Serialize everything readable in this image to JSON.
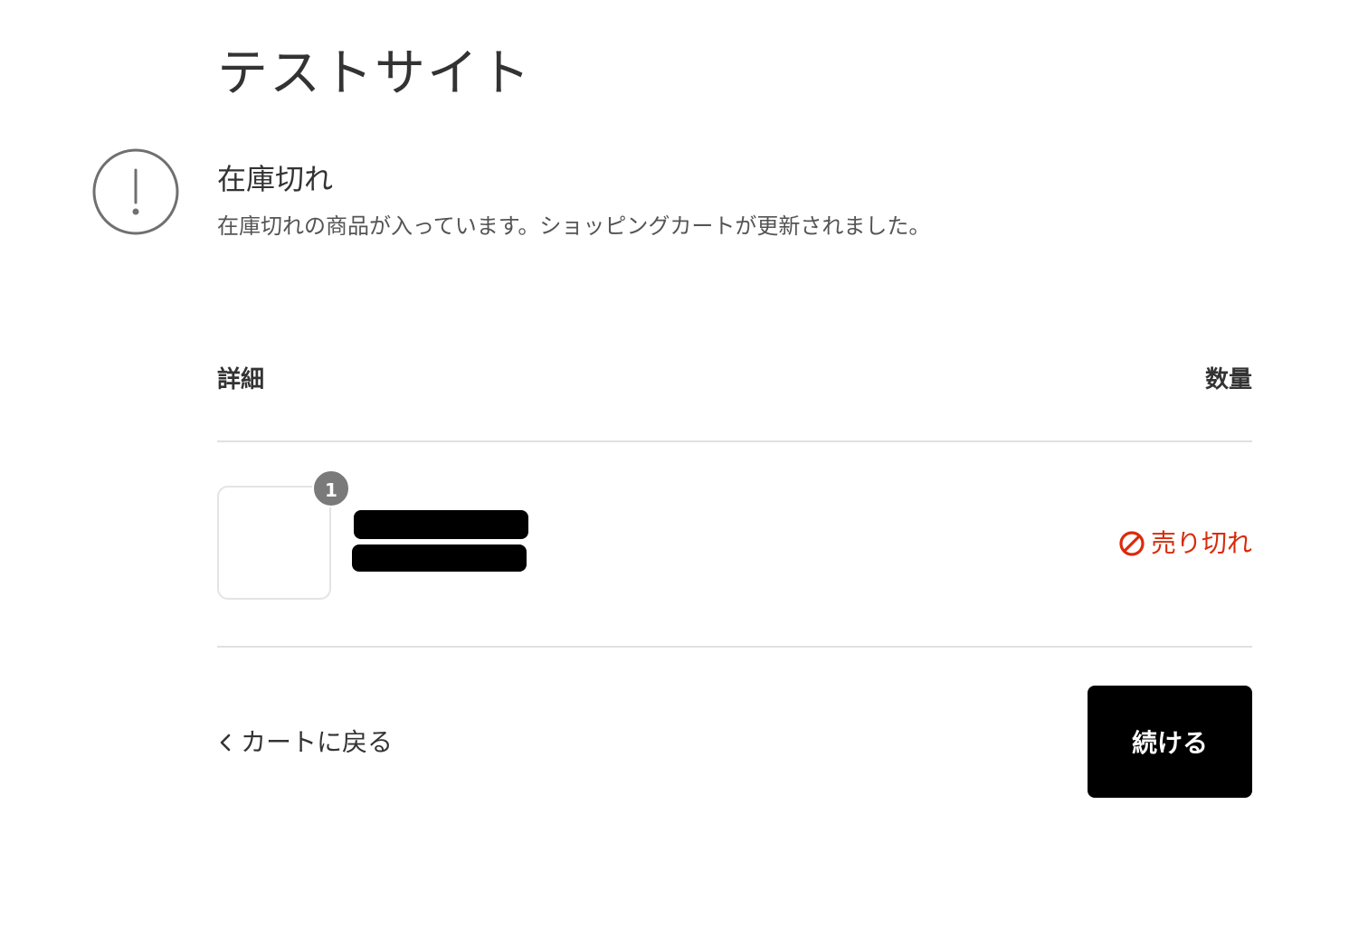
{
  "header": {
    "site_title": "テストサイト"
  },
  "alert": {
    "icon": "exclamation-circle-icon",
    "title": "在庫切れ",
    "message": "在庫切れの商品が入っています。ショッピングカートが更新されました。"
  },
  "table": {
    "columns": [
      "詳細",
      "数量"
    ],
    "items": [
      {
        "quantity_badge": "1",
        "name": "[redacted]",
        "variant": "[redacted]",
        "status_icon": "prohibited-icon",
        "status": "売り切れ"
      }
    ]
  },
  "footer": {
    "back_icon": "chevron-left-icon",
    "back_label": "カートに戻る",
    "continue_label": "続ける"
  },
  "colors": {
    "text": "#333333",
    "muted": "#545454",
    "divider": "#e1e1e1",
    "badge": "#7a7a7a",
    "error": "#d82c0d",
    "button_bg": "#000000",
    "button_text": "#ffffff"
  }
}
